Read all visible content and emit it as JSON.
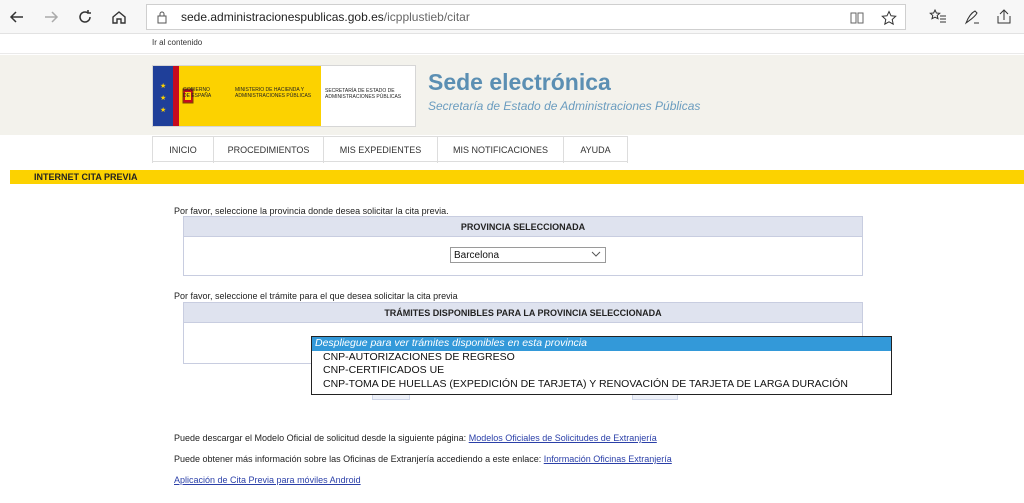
{
  "browser": {
    "url_host": "sede.administracionespublicas.gob.es",
    "url_path": "/icpplustieb/citar"
  },
  "skip_link": "Ir al contenido",
  "header": {
    "gov_label": "GOBIERNO DE ESPAÑA",
    "ministry_label": "MINISTERIO DE HACIENDA Y ADMINISTRACIONES PÚBLICAS",
    "secretaria_label": "SECRETARÍA DE ESTADO DE ADMINISTRACIONES PÚBLICAS",
    "title": "Sede electrónica",
    "subtitle": "Secretaría de Estado de Administraciones Públicas"
  },
  "menu": [
    {
      "label": "INICIO"
    },
    {
      "label": "PROCEDIMIENTOS"
    },
    {
      "label": "MIS EXPEDIENTES"
    },
    {
      "label": "MIS NOTIFICACIONES"
    },
    {
      "label": "AYUDA"
    }
  ],
  "section_title": "INTERNET CITA PREVIA",
  "province": {
    "prompt": "Por favor, seleccione la provincia donde desea solicitar la cita previa.",
    "header": "PROVINCIA SELECCIONADA",
    "selected": "Barcelona"
  },
  "tramite": {
    "prompt": "Por favor, seleccione el trámite para el que desea solicitar la cita previa",
    "header": "TRÁMITES DISPONIBLES PARA LA PROVINCIA SELECCIONADA",
    "options": [
      "Despliegue para ver trámites disponibles en esta provincia",
      "CNP-AUTORIZACIONES DE REGRESO",
      "CNP-CERTIFICADOS UE",
      "CNP-TOMA DE HUELLAS (EXPEDICIÓN DE TARJETA) Y RENOVACIÓN DE TARJETA DE LARGA DURACIÓN"
    ]
  },
  "info": {
    "line1_text": "Puede descargar el Modelo Oficial de solicitud desde la siguiente página:",
    "line1_link": " Modelos Oficiales de Solicitudes de Extranjería",
    "line2_text": "Puede obtener más información sobre las Oficinas de Extranjería accediendo a este enlace:",
    "line2_link": "Información Oficinas Extranjería",
    "line3_link": "Aplicación de Cita Previa para móviles Android"
  },
  "colors": {
    "accent_yellow": "#fcd200",
    "title_blue": "#5b8fb3",
    "link_blue": "#2a3fa8",
    "dropdown_highlight": "#3399d9"
  }
}
